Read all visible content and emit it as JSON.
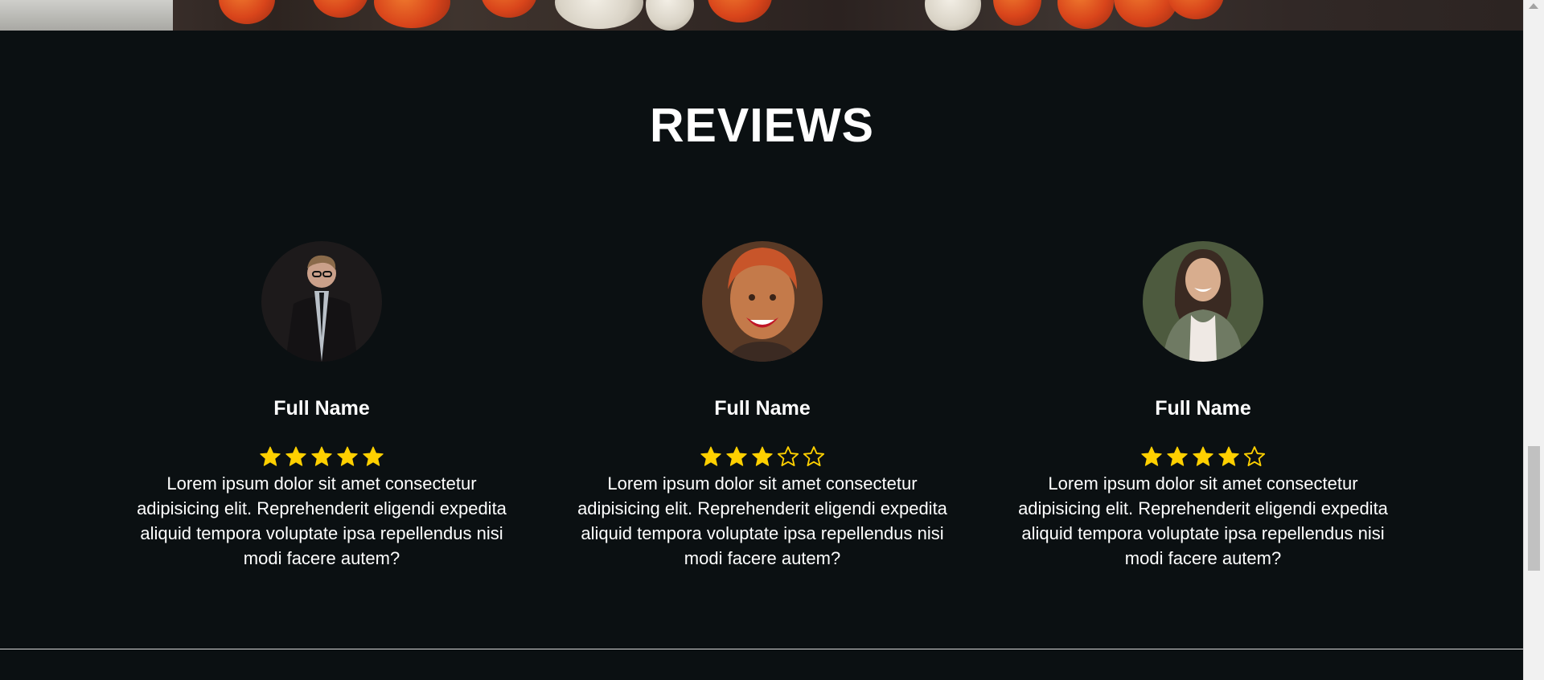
{
  "reviews": {
    "title": "REVIEWS",
    "items": [
      {
        "name": "Full Name",
        "rating": 5,
        "text": "Lorem ipsum dolor sit amet consectetur adipisicing elit. Reprehenderit eligendi expedita aliquid tempora voluptate ipsa repellendus nisi modi facere autem?"
      },
      {
        "name": "Full Name",
        "rating": 3,
        "text": "Lorem ipsum dolor sit amet consectetur adipisicing elit. Reprehenderit eligendi expedita aliquid tempora voluptate ipsa repellendus nisi modi facere autem?"
      },
      {
        "name": "Full Name",
        "rating": 4,
        "text": "Lorem ipsum dolor sit amet consectetur adipisicing elit. Reprehenderit eligendi expedita aliquid tempora voluptate ipsa repellendus nisi modi facere autem?"
      }
    ],
    "max_rating": 5
  },
  "colors": {
    "background": "#0b1012",
    "star": "#ffd000",
    "text": "#ffffff"
  },
  "icons": [
    "star-filled-icon",
    "star-outline-icon"
  ]
}
